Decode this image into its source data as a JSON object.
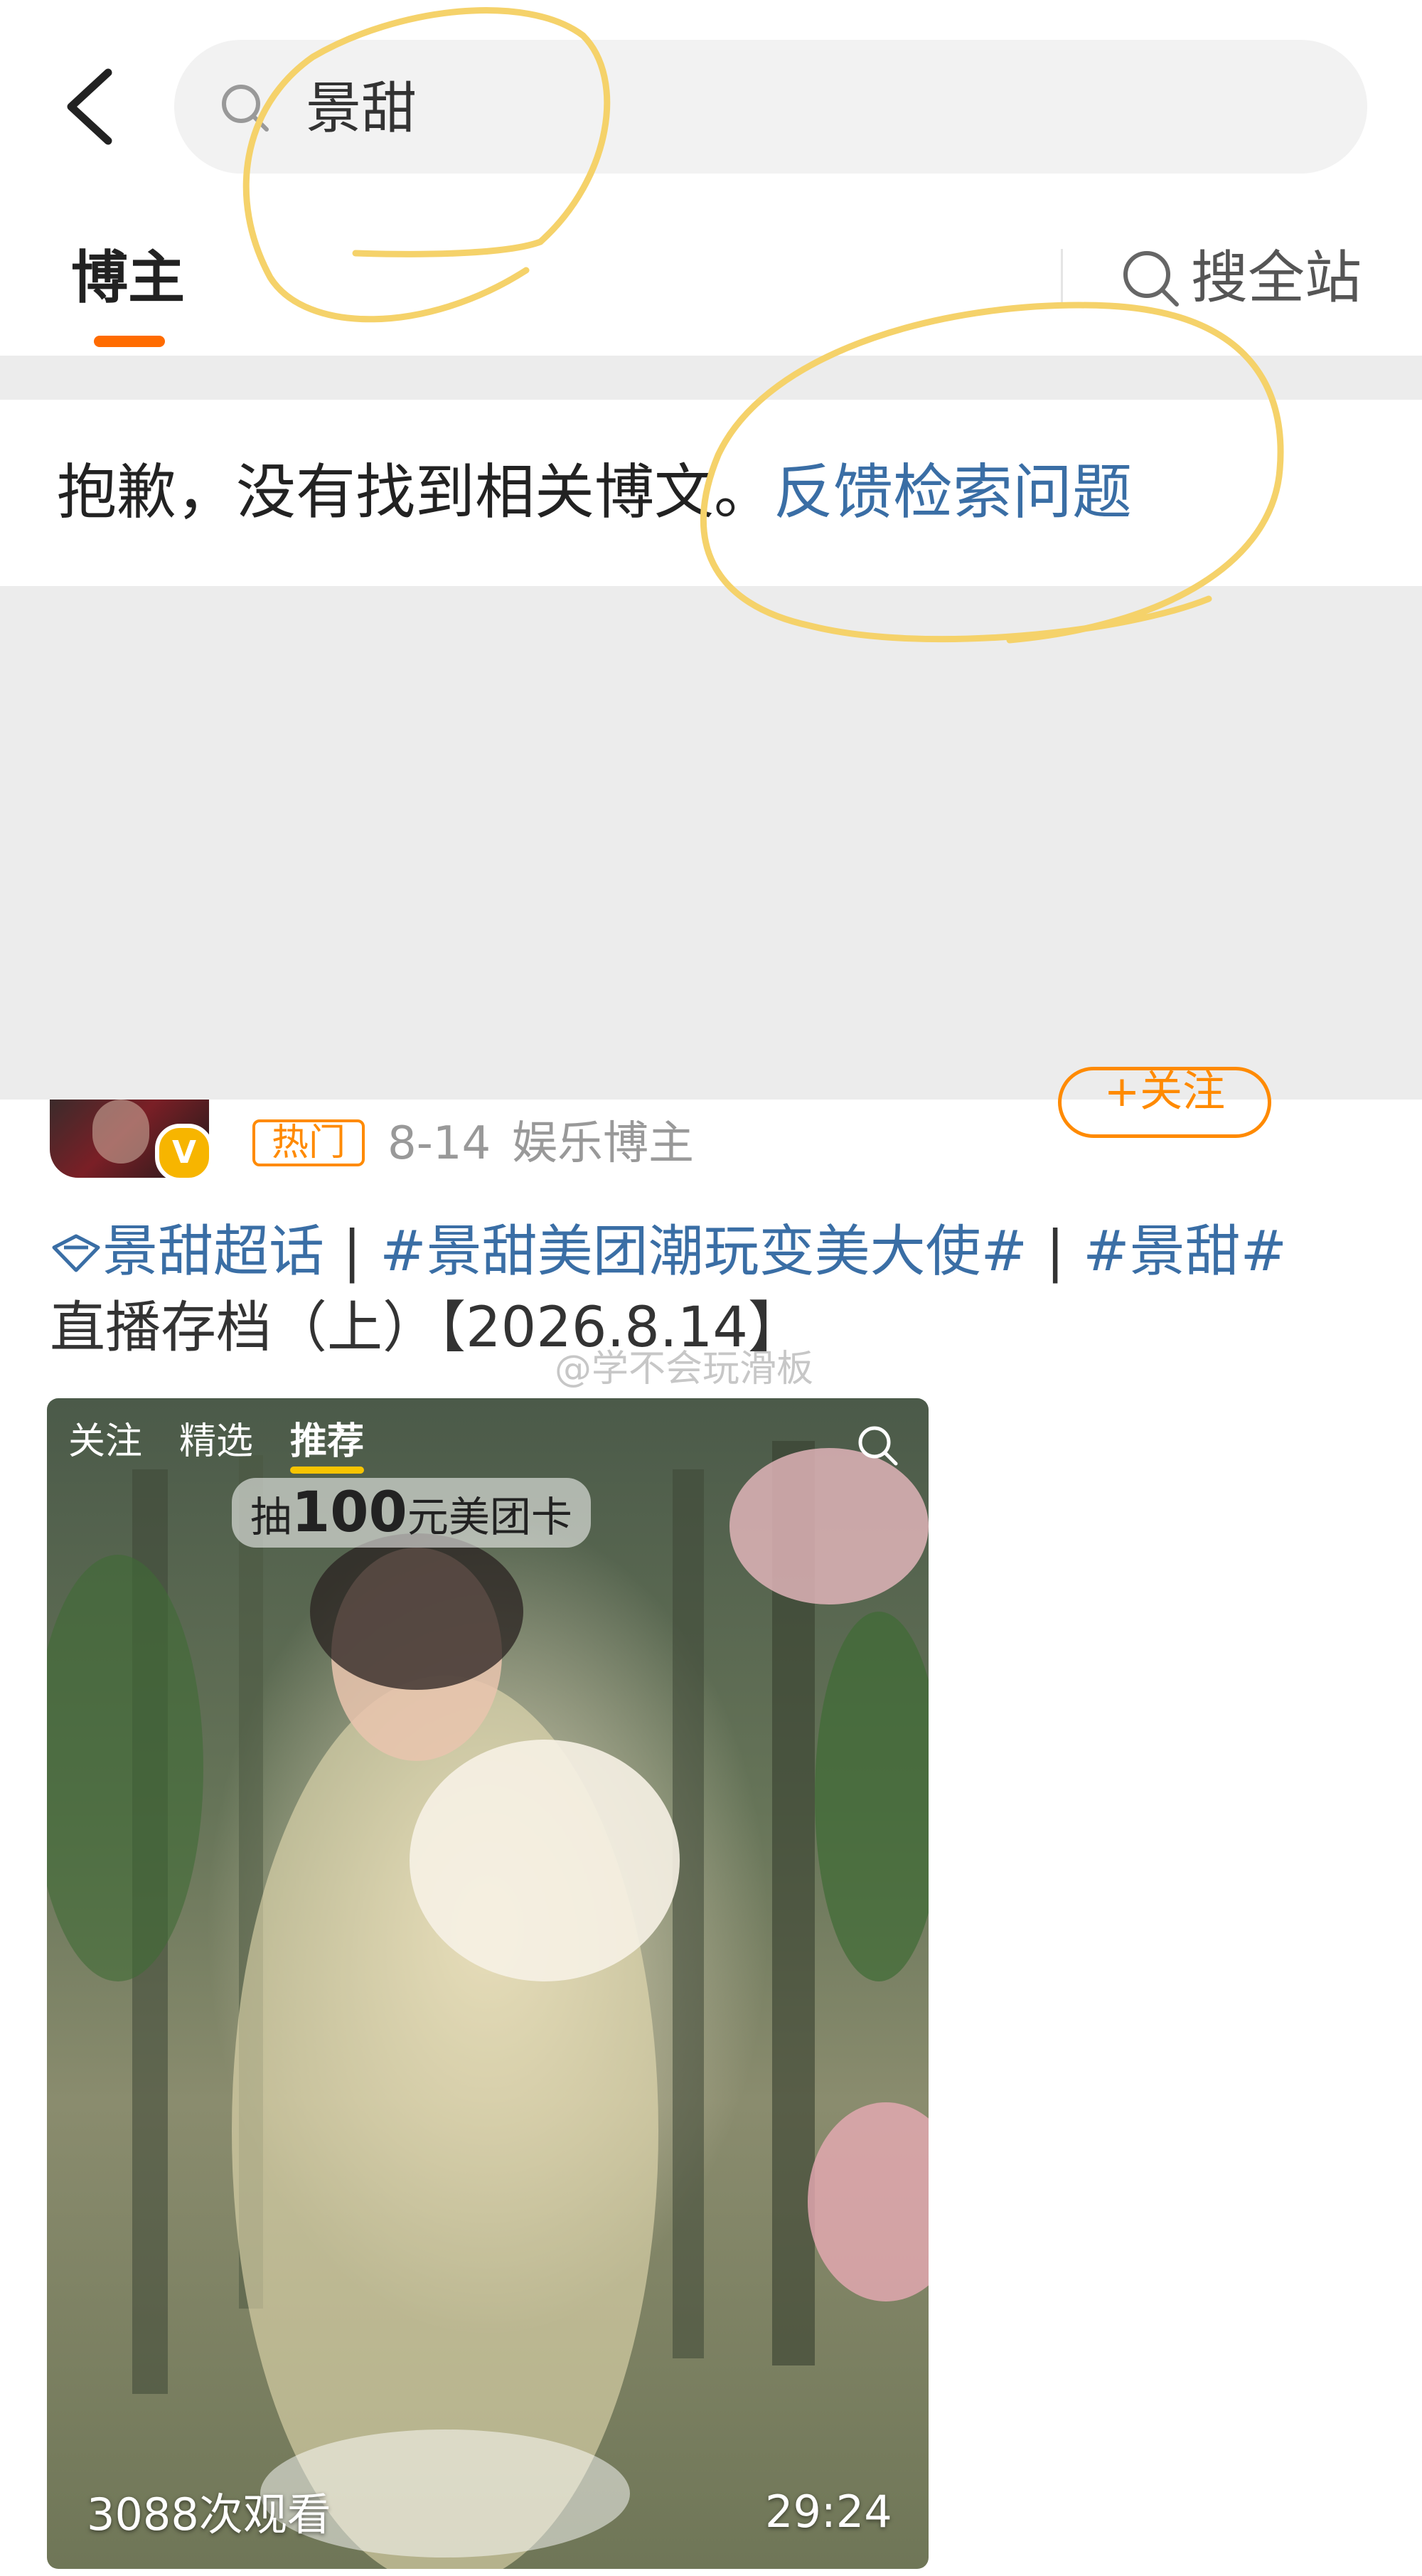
{
  "search": {
    "query": "景甜"
  },
  "tabs": {
    "blogger": "博主",
    "search_all": "搜全站"
  },
  "message": {
    "text": "抱歉，没有找到相关博文。",
    "link": "反馈检索问题"
  },
  "post": {
    "follow_label": "+关注",
    "verified_mark": "V",
    "hot_badge": "热门",
    "date": "8-14",
    "author_tag": "娱乐博主",
    "super_topic": "景甜超话",
    "separator": "|",
    "hashtag_1": "#景甜美团潮玩变美大使#",
    "hashtag_2": "#景甜#",
    "body_line_2": "直播存档（上）【2026.8.14】",
    "watermark": "@学不会玩滑板"
  },
  "video": {
    "tab_follow": "关注",
    "tab_picks": "精选",
    "tab_recommend": "推荐",
    "promo_prefix": "抽",
    "promo_amount": "100",
    "promo_suffix": "元美团卡",
    "views": "3088次观看",
    "duration": "29:24"
  },
  "colors": {
    "accent": "#ff6b00",
    "link": "#3a6ea5",
    "annotation": "#f5d26a"
  }
}
